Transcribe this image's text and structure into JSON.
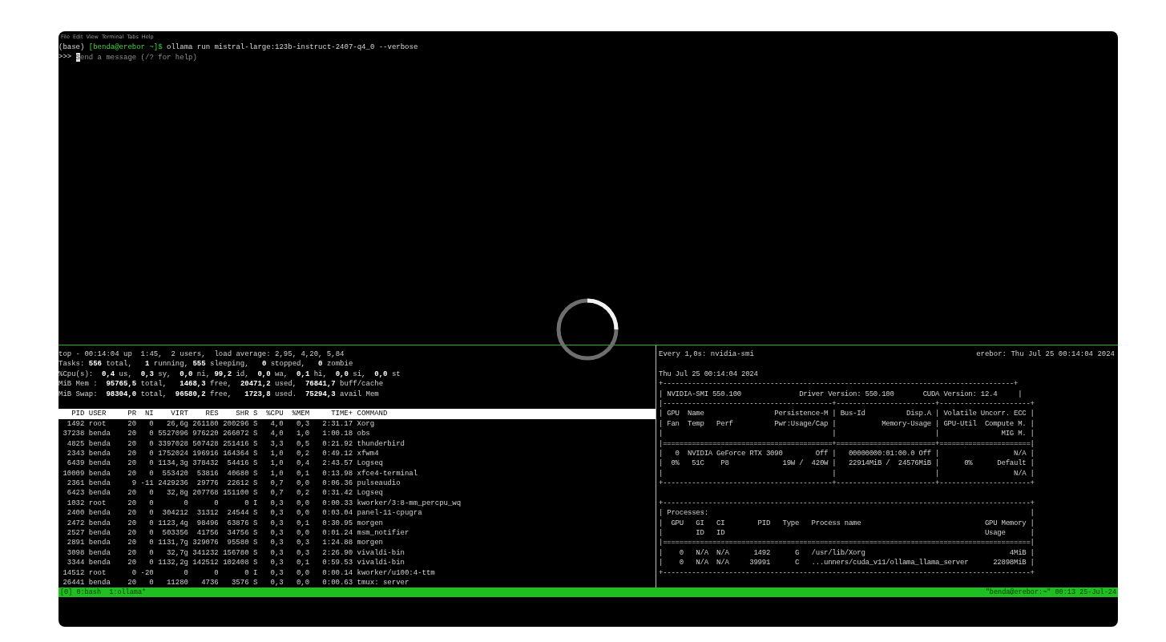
{
  "menu": [
    "File",
    "Edit",
    "View",
    "Terminal",
    "Tabs",
    "Help"
  ],
  "ollama_pane": {
    "command_line": {
      "env": "(base)",
      "prompt": "[benda@erebor ~]$",
      "command": "ollama run mistral-large:123b-instruct-2407-q4_0 --verbose"
    },
    "input": {
      "prompt": ">>>",
      "placeholder": "Send a message (/? for help)"
    }
  },
  "top_summary": [
    "top - 00:14:04 up  1:45,  2 users,  load average: 2,95, 4,20, 5,84",
    "Tasks: **556** total,   **1** running, **555** sleeping,   **0** stopped,   **0** zombie",
    "%Cpu(s):  **0,4** us,  **0,3** sy,  **0,0** ni, **99,2** id,  **0,0** wa,  **0,1** hi,  **0,0** si,  **0,0** st",
    "MiB Mem :  **95765,5** total,   **1468,3** free,  **20471,2** used,  **76841,7** buff/cache",
    "MiB Swap:  **98304,0** total,  **96580,2** free,   **1723,8** used.  **75294,3** avail Mem"
  ],
  "process_table": {
    "columns": [
      "PID",
      "USER",
      "PR",
      "NI",
      "VIRT",
      "RES",
      "SHR",
      "S",
      "%CPU",
      "%MEM",
      "TIME+",
      "COMMAND"
    ],
    "rows": [
      [
        "1492",
        "root",
        "20",
        "0",
        "26,6g",
        "261180",
        "200296",
        "S",
        "4,0",
        "0,3",
        "2:31.17",
        "Xorg"
      ],
      [
        "37238",
        "benda",
        "20",
        "0",
        "5527096",
        "976220",
        "266072",
        "S",
        "4,0",
        "1,0",
        "1:00.18",
        "obs"
      ],
      [
        "4825",
        "benda",
        "20",
        "0",
        "3397028",
        "507428",
        "251416",
        "S",
        "3,3",
        "0,5",
        "0:21.92",
        "thunderbird"
      ],
      [
        "2343",
        "benda",
        "20",
        "0",
        "1752024",
        "196916",
        "164364",
        "S",
        "1,0",
        "0,2",
        "0:49.12",
        "xfwm4"
      ],
      [
        "6439",
        "benda",
        "20",
        "0",
        "1134,3g",
        "378432",
        "54416",
        "S",
        "1,0",
        "0,4",
        "2:43.57",
        "Logseq"
      ],
      [
        "10009",
        "benda",
        "20",
        "0",
        "553420",
        "53816",
        "40680",
        "S",
        "1,0",
        "0,1",
        "0:13.98",
        "xfce4-terminal"
      ],
      [
        "2361",
        "benda",
        "9",
        "-11",
        "2429236",
        "29776",
        "22612",
        "S",
        "0,7",
        "0,0",
        "0:06.36",
        "pulseaudio"
      ],
      [
        "6423",
        "benda",
        "20",
        "0",
        "32,8g",
        "207768",
        "151100",
        "S",
        "0,7",
        "0,2",
        "0:31.42",
        "Logseq"
      ],
      [
        "1032",
        "root",
        "20",
        "0",
        "0",
        "0",
        "0",
        "I",
        "0,3",
        "0,0",
        "0:00.33",
        "kworker/3:8-mm_percpu_wq"
      ],
      [
        "2400",
        "benda",
        "20",
        "0",
        "304212",
        "31312",
        "24544",
        "S",
        "0,3",
        "0,0",
        "0:03.04",
        "panel-11-cpugra"
      ],
      [
        "2472",
        "benda",
        "20",
        "0",
        "1123,4g",
        "98496",
        "63876",
        "S",
        "0,3",
        "0,1",
        "0:30.95",
        "morgen"
      ],
      [
        "2527",
        "benda",
        "20",
        "0",
        "503356",
        "41756",
        "34756",
        "S",
        "0,3",
        "0,0",
        "0:01.24",
        "msm_notifier"
      ],
      [
        "2891",
        "benda",
        "20",
        "0",
        "1131,7g",
        "329076",
        "95580",
        "S",
        "0,3",
        "0,3",
        "1:24.88",
        "morgen"
      ],
      [
        "3098",
        "benda",
        "20",
        "0",
        "32,7g",
        "341232",
        "156780",
        "S",
        "0,3",
        "0,3",
        "2:26.90",
        "vivaldi-bin"
      ],
      [
        "3344",
        "benda",
        "20",
        "0",
        "1132,2g",
        "142512",
        "102408",
        "S",
        "0,3",
        "0,1",
        "0:59.53",
        "vivaldi-bin"
      ],
      [
        "14512",
        "root",
        "0",
        "-20",
        "0",
        "0",
        "0",
        "I",
        "0,3",
        "0,0",
        "0:00.14",
        "kworker/u100:4-ttm"
      ],
      [
        "26441",
        "benda",
        "20",
        "0",
        "11280",
        "4736",
        "3576",
        "S",
        "0,3",
        "0,0",
        "0:00.63",
        "tmux: server"
      ]
    ]
  },
  "nvidia_smi": {
    "header": "Every 1,0s: nvidia-smi",
    "host_time": "erebor: Thu Jul 25 00:14:04 2024",
    "date": "Thu Jul 25 00:14:04 2024",
    "lines": [
      "+-------------------------------------------------------------------------------------+",
      "| NVIDIA-SMI 550.100              Driver Version: 550.100       CUDA Version: 12.4     |",
      "|-----------------------------------------+------------------------+----------------------+",
      "| GPU  Name                 Persistence-M | Bus-Id          Disp.A | Volatile Uncorr. ECC |",
      "| Fan  Temp   Perf          Pwr:Usage/Cap |           Memory-Usage | GPU-Util  Compute M. |",
      "|                                         |                        |               MIG M. |",
      "|=========================================+========================+======================|",
      "|   0  NVIDIA GeForce RTX 3090        Off |   00000000:01:00.0 Off |                  N/A |",
      "|  0%   51C    P8             19W /  420W |   22914MiB /  24576MiB |      0%      Default |",
      "|                                         |                        |                  N/A |",
      "+-----------------------------------------+------------------------+----------------------+"
    ],
    "process_lines": [
      "+-----------------------------------------------------------------------------------------+",
      "| Processes:                                                                              |",
      "|  GPU   GI   CI        PID   Type   Process name                              GPU Memory |",
      "|        ID   ID                                                               Usage      |",
      "|=========================================================================================|",
      "|    0   N/A  N/A      1492      G   /usr/lib/Xorg                                   4MiB |",
      "|    0   N/A  N/A     39991      C   ...unners/cuda_v11/ollama_llama_server      22898MiB |",
      "+-----------------------------------------------------------------------------------------+"
    ]
  },
  "status_bar": {
    "windows": "[0] 0:bash  1:ollama*",
    "right": "\"benda@erebor:~\" 00:13 25-Jul-24"
  }
}
